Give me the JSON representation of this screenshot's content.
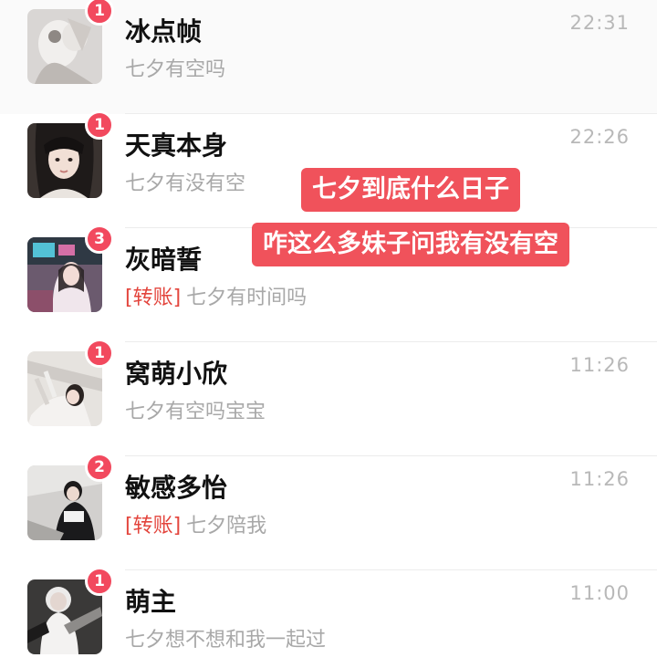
{
  "chats": [
    {
      "name": "冰点帧",
      "preview_tag": "",
      "preview": "七夕有空吗",
      "time": "22:31",
      "unread": "1"
    },
    {
      "name": "天真本身",
      "preview_tag": "",
      "preview": "七夕有没有空",
      "time": "22:26",
      "unread": "1"
    },
    {
      "name": "灰暗誓",
      "preview_tag": "[转账]",
      "preview": "七夕有时间吗",
      "time": "",
      "unread": "3"
    },
    {
      "name": "窝萌小欣",
      "preview_tag": "",
      "preview": "七夕有空吗宝宝",
      "time": "11:26",
      "unread": "1"
    },
    {
      "name": "敏感多怡",
      "preview_tag": "[转账]",
      "preview": "七夕陪我",
      "time": "11:26",
      "unread": "2"
    },
    {
      "name": "萌主",
      "preview_tag": "",
      "preview": "七夕想不想和我一起过",
      "time": "11:00",
      "unread": "1"
    }
  ],
  "captions": {
    "line1": "七夕到底什么日子",
    "line2": "咋这么多妹子问我有没有空"
  },
  "colors": {
    "badge": "#f2495e",
    "caption_bg": "#f0525b",
    "transfer_tag": "#e3453d"
  }
}
